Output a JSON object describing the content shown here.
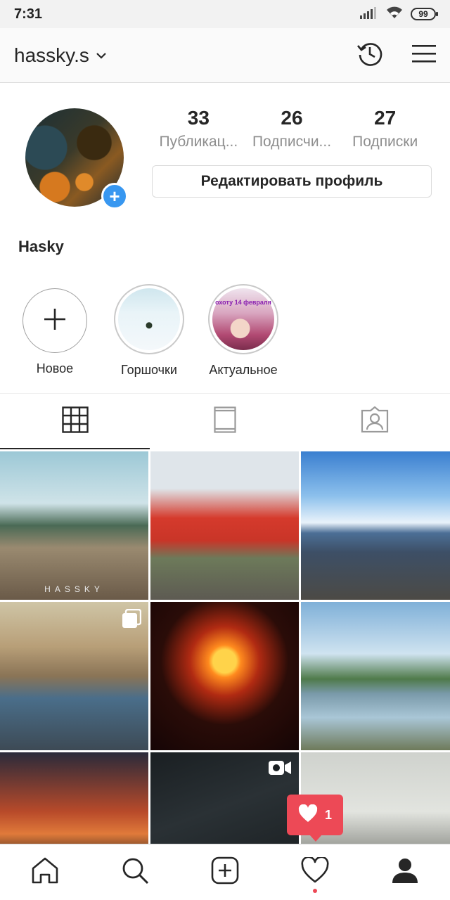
{
  "status_bar": {
    "time": "7:31",
    "battery": "99"
  },
  "header": {
    "username": "hassky.s"
  },
  "profile": {
    "display_name": "Hasky",
    "stats": [
      {
        "count": "33",
        "label": "Публикац..."
      },
      {
        "count": "26",
        "label": "Подписчи..."
      },
      {
        "count": "27",
        "label": "Подписки"
      }
    ],
    "edit_button": "Редактировать профиль"
  },
  "highlights": [
    {
      "label": "Новое"
    },
    {
      "label": "Горшочки"
    },
    {
      "label": "Актуальное",
      "overlay_text": "охоту 14 февраля"
    }
  ],
  "grid": {
    "watermark": "HASSKY",
    "badges": {
      "carousel": "carousel-icon",
      "video": "video-icon"
    }
  },
  "activity_popup": {
    "count": "1"
  },
  "colors": {
    "accent": "#3897f0",
    "notification": "#ed4956"
  }
}
